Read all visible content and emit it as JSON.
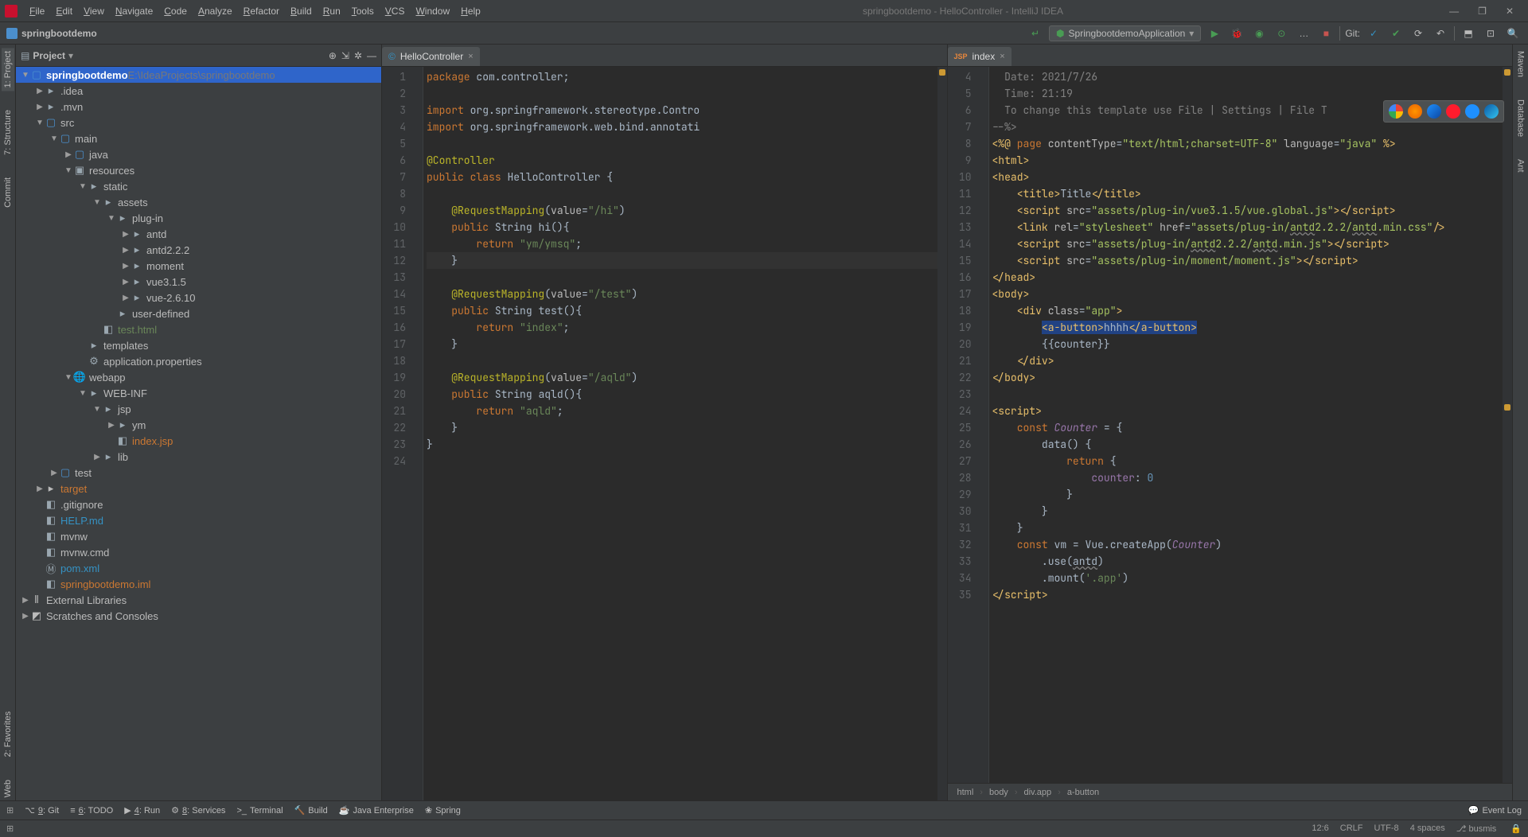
{
  "menus": [
    "File",
    "Edit",
    "View",
    "Navigate",
    "Code",
    "Analyze",
    "Refactor",
    "Build",
    "Run",
    "Tools",
    "VCS",
    "Window",
    "Help"
  ],
  "window_title": "springbootdemo - HelloController - IntelliJ IDEA",
  "breadcrumb": {
    "project": "springbootdemo"
  },
  "run_config": "SpringbootdemoApplication",
  "git_label": "Git:",
  "project_panel": {
    "title": "Project"
  },
  "tree": {
    "root": {
      "name": "springbootdemo",
      "path": "E:\\IdeaProjects\\springbootdemo"
    },
    "idea": ".idea",
    "mvn": ".mvn",
    "src": "src",
    "main": "main",
    "java": "java",
    "resources": "resources",
    "static": "static",
    "assets": "assets",
    "plugin": "plug-in",
    "antd": "antd",
    "antd2": "antd2.2.2",
    "moment": "moment",
    "vue315": "vue3.1.5",
    "vue2610": "vue-2.6.10",
    "userdef": "user-defined",
    "testhtml": "test.html",
    "templates": "templates",
    "appprops": "application.properties",
    "webapp": "webapp",
    "webinf": "WEB-INF",
    "jsp": "jsp",
    "ym": "ym",
    "indexjsp": "index.jsp",
    "lib": "lib",
    "test": "test",
    "target": "target",
    "gitignore": ".gitignore",
    "help": "HELP.md",
    "mvnw": "mvnw",
    "mvnwcmd": "mvnw.cmd",
    "pom": "pom.xml",
    "iml": "springbootdemo.iml",
    "ext": "External Libraries",
    "scratch": "Scratches and Consoles"
  },
  "tabs": {
    "left": "HelloController",
    "right": "index"
  },
  "editor_left": {
    "gutter": [
      "1",
      "2",
      "3",
      "4",
      "5",
      "6",
      "7",
      "8",
      "9",
      "10",
      "11",
      "12",
      "13",
      "14",
      "15",
      "16",
      "17",
      "18",
      "19",
      "20",
      "21",
      "22",
      "23",
      "24"
    ],
    "code": [
      {
        "t": "java",
        "raw": "package com.controller;"
      },
      {
        "t": "blank"
      },
      {
        "t": "java",
        "raw": "import org.springframework.stereotype.Contro"
      },
      {
        "t": "java",
        "raw": "import org.springframework.web.bind.annotati"
      },
      {
        "t": "blank"
      },
      {
        "t": "ann",
        "raw": "@Controller"
      },
      {
        "t": "java",
        "raw": "public class HelloController {"
      },
      {
        "t": "blank"
      },
      {
        "t": "ann2",
        "k": "@RequestMapping",
        "a": "(value=",
        "s": "\"/hi\"",
        "e": ")"
      },
      {
        "t": "java",
        "raw": "    public String hi(){"
      },
      {
        "t": "ret",
        "s": "\"ym/ymsq\""
      },
      {
        "t": "close",
        "raw": "    }"
      },
      {
        "t": "blank"
      },
      {
        "t": "ann2",
        "k": "@RequestMapping",
        "a": "(value=",
        "s": "\"/test\"",
        "e": ")"
      },
      {
        "t": "java",
        "raw": "    public String test(){"
      },
      {
        "t": "ret",
        "s": "\"index\""
      },
      {
        "t": "close",
        "raw": "    }"
      },
      {
        "t": "blank"
      },
      {
        "t": "ann2",
        "k": "@RequestMapping",
        "a": "(value=",
        "s": "\"/aqld\"",
        "e": ")"
      },
      {
        "t": "java",
        "raw": "    public String aqld(){"
      },
      {
        "t": "ret",
        "s": "\"aqld\""
      },
      {
        "t": "close",
        "raw": "    }"
      },
      {
        "t": "close",
        "raw": "}"
      },
      {
        "t": "blank"
      }
    ]
  },
  "editor_right": {
    "gutter": [
      "4",
      "5",
      "6",
      "7",
      "8",
      "9",
      "10",
      "11",
      "12",
      "13",
      "14",
      "15",
      "16",
      "17",
      "18",
      "19",
      "20",
      "21",
      "22",
      "23",
      "24",
      "25",
      "26",
      "27",
      "28",
      "29",
      "30",
      "31",
      "32",
      "33",
      "34",
      "35"
    ],
    "breadcrumb": [
      "html",
      "body",
      "div.app",
      "a-button"
    ]
  },
  "bottom_tools": [
    {
      "icon": "⌥",
      "label": "9: Git",
      "u": "9"
    },
    {
      "icon": "≡",
      "label": "6: TODO",
      "u": "6"
    },
    {
      "icon": "▶",
      "label": "4: Run",
      "u": "4"
    },
    {
      "icon": "⚙",
      "label": "8: Services",
      "u": "8"
    },
    {
      "icon": ">_",
      "label": "Terminal"
    },
    {
      "icon": "🔨",
      "label": "Build"
    },
    {
      "icon": "☕",
      "label": "Java Enterprise"
    },
    {
      "icon": "❀",
      "label": "Spring"
    }
  ],
  "event_log": "Event Log",
  "status": {
    "pos": "12:6",
    "eol": "CRLF",
    "enc": "UTF-8",
    "indent": "4 spaces",
    "branch": "busmis"
  },
  "side_left": [
    "1: Project",
    "7: Structure",
    "Commit",
    "2: Favorites",
    "Web"
  ],
  "side_right": [
    "Maven",
    "Database",
    "Ant"
  ]
}
